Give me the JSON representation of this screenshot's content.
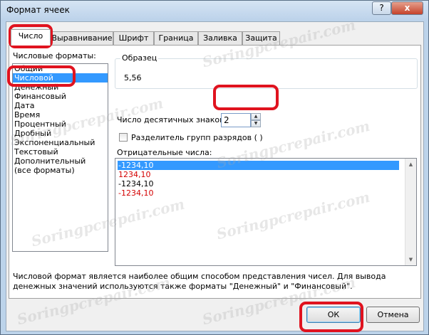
{
  "window": {
    "title": "Формат ячеек",
    "help_label": "?",
    "close_label": "x"
  },
  "tabs": [
    {
      "label": "Число",
      "active": true
    },
    {
      "label": "Выравнивание"
    },
    {
      "label": "Шрифт"
    },
    {
      "label": "Граница"
    },
    {
      "label": "Заливка"
    },
    {
      "label": "Защита"
    }
  ],
  "number_formats": {
    "label": "Числовые форматы:",
    "items": [
      "Общий",
      "Числовой",
      "Денежный",
      "Финансовый",
      "Дата",
      "Время",
      "Процентный",
      "Дробный",
      "Экспоненциальный",
      "Текстовый",
      "Дополнительный",
      "(все форматы)"
    ],
    "selected_index": 1
  },
  "sample": {
    "label": "Образец",
    "value": "5,56"
  },
  "decimal_places": {
    "label": "Число десятичных знаков:",
    "value": "2"
  },
  "thousands_separator": {
    "label": "Разделитель групп разрядов ( )",
    "checked": false
  },
  "negative_numbers": {
    "label": "Отрицательные числа:",
    "items": [
      {
        "text": "-1234,10",
        "color": "#000000",
        "selected": true
      },
      {
        "text": "1234,10",
        "color": "#d40000"
      },
      {
        "text": "-1234,10",
        "color": "#000000"
      },
      {
        "text": "-1234,10",
        "color": "#d40000"
      }
    ]
  },
  "description": "Числовой формат является наиболее общим способом представления чисел. Для вывода денежных значений используются также форматы \"Денежный\" и \"Финансовый\".",
  "buttons": {
    "ok": "ОК",
    "cancel": "Отмена"
  },
  "watermark": "Soringpcrepair.com",
  "colors": {
    "highlight": "#e0131f",
    "selection": "#3399ff",
    "negative_red": "#d40000"
  }
}
